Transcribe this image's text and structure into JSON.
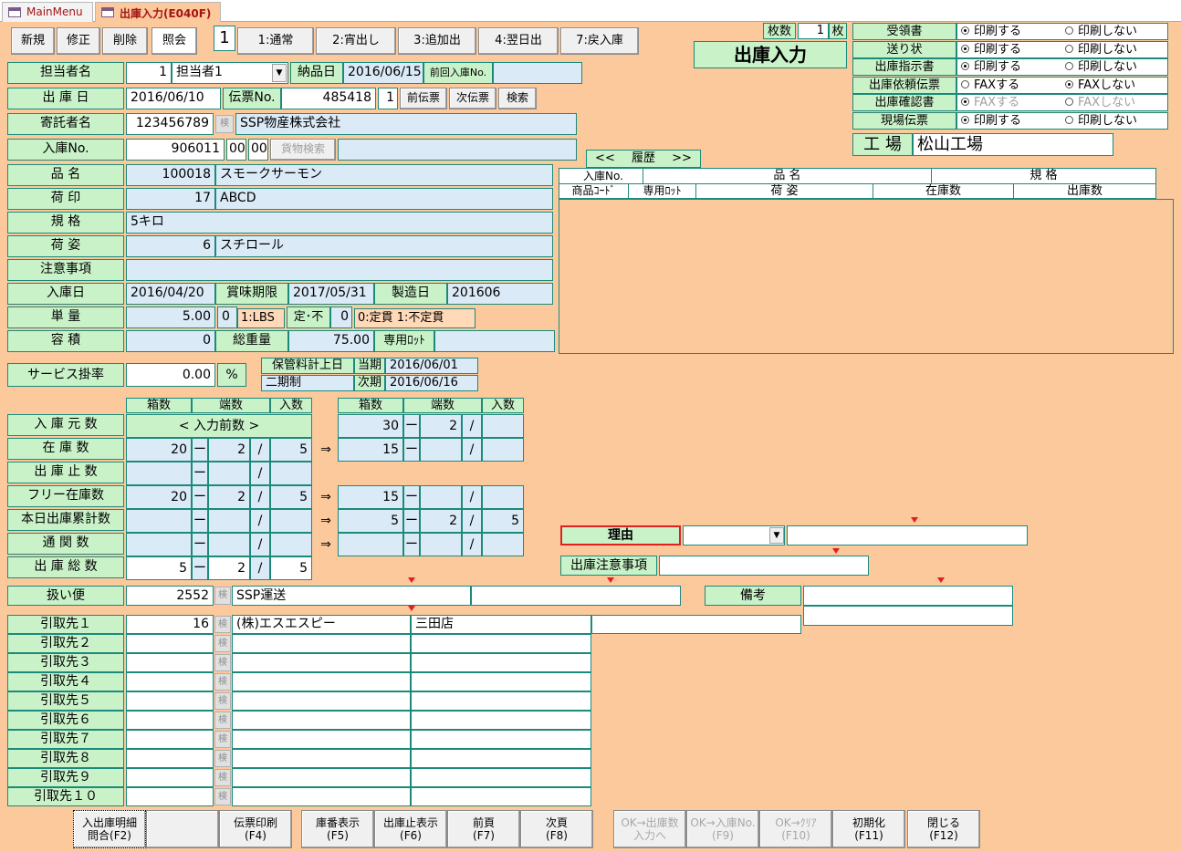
{
  "tabs": {
    "main": "MainMenu",
    "active": "出庫入力(E040F)"
  },
  "modes": {
    "new": "新規",
    "edit": "修正",
    "delete": "削除",
    "view": "照会",
    "current": "1"
  },
  "types": {
    "t1": "1:通常",
    "t2": "2:宵出し",
    "t3": "3:追加出",
    "t4": "4:翌日出",
    "t7": "7:戻入庫"
  },
  "sheets": {
    "label": "枚数",
    "value": "1",
    "unit": "枚"
  },
  "title": "出庫入力",
  "print": {
    "opt_print": "印刷する",
    "opt_noprint": "印刷しない",
    "opt_fax": "FAXする",
    "opt_nofax": "FAXしない",
    "rows": [
      {
        "label": "受領書",
        "sel": "print"
      },
      {
        "label": "送り状",
        "sel": "print"
      },
      {
        "label": "出庫指示書",
        "sel": "print"
      },
      {
        "label": "出庫依頼伝票",
        "sel": "nofax"
      },
      {
        "label": "出庫確認書",
        "sel": "fax"
      },
      {
        "label": "現場伝票",
        "sel": "print"
      }
    ]
  },
  "factory": {
    "label": "工 場",
    "value": "松山工場"
  },
  "form": {
    "staff_label": "担当者名",
    "staff_no": "1",
    "staff_name": "担当者1",
    "delivery_label": "納品日",
    "delivery_date": "2016/06/15",
    "prev_label": "前回入庫No.",
    "ship_label": "出 庫 日",
    "ship_date": "2016/06/10",
    "slip_label": "伝票No.",
    "slip_no": "485418",
    "slip_sub": "1",
    "prev_slip": "前伝票",
    "next_slip": "次伝票",
    "search": "検索",
    "consignor_label": "寄託者名",
    "consignor_code": "123456789",
    "kbtn": "検",
    "consignor_name": "SSP物産株式会社",
    "recv_label": "入庫No.",
    "recv_no": "906011",
    "recv_a": "00",
    "recv_b": "00",
    "cargo_search": "貨物検索",
    "item_label": "品 名",
    "item_code": "100018",
    "item_name": "スモークサーモン",
    "mark_label": "荷 印",
    "mark_code": "17",
    "mark_name": "ABCD",
    "spec_label": "規 格",
    "spec_value": "5キロ",
    "pack_label": "荷 姿",
    "pack_code": "6",
    "pack_name": "スチロール",
    "note_label": "注意事項",
    "indate_label": "入庫日",
    "indate": "2016/04/20",
    "best_label": "賞味期限",
    "best": "2017/05/31",
    "mfg_label": "製造日",
    "mfg": "201606",
    "unit_label": "単 量",
    "unit_value": "5.00",
    "unit_flag": "0",
    "unit_name": "1:LBS",
    "fix_label": "定･不",
    "fix_value": "0",
    "fix_name": "0:定貫 1:不定貫",
    "vol_label": "容 積",
    "vol_value": "0",
    "weight_label": "総重量",
    "weight_value": "75.00",
    "lot_label": "専用ﾛｯﾄ",
    "service_label": "サービス掛率",
    "service_value": "0.00",
    "service_unit": "%",
    "storage_label": "保管料計上日",
    "cur_label": "当期",
    "cur_date": "2016/06/01",
    "period_label": "二期制",
    "next_label": "次期",
    "next_date": "2016/06/16"
  },
  "history": {
    "prev": "<<",
    "label": "履歴",
    "next": ">>",
    "h1": [
      "入庫No.",
      "品 名",
      "規 格"
    ],
    "h2": [
      "商品ｺｰﾄﾞ",
      "専用ﾛｯﾄ",
      "荷 姿",
      "在庫数",
      "出庫数"
    ]
  },
  "qty": {
    "h_box": "箱数",
    "h_frac": "端数",
    "h_in": "入数",
    "arrow": "⇒",
    "dash": "ー",
    "slash": "/",
    "rows": [
      {
        "label": "入 庫 元 数",
        "lbox": "",
        "lfrac": "",
        "lin": "",
        "rbox": "30",
        "rfrac": "2",
        "rin": ""
      },
      {
        "label": "在 庫 数",
        "lbox": "20",
        "lfrac": "2",
        "lin": "5",
        "rbox": "15",
        "rfrac": "",
        "rin": ""
      },
      {
        "label": "出 庫 止 数",
        "lbox": "",
        "lfrac": "",
        "lin": ""
      },
      {
        "label": "フリー在庫数",
        "lbox": "20",
        "lfrac": "2",
        "lin": "5",
        "rbox": "15",
        "rfrac": "",
        "rin": ""
      },
      {
        "label": "本日出庫累計数",
        "lbox": "",
        "lfrac": "",
        "lin": "",
        "rbox": "5",
        "rfrac": "2",
        "rin": "5"
      },
      {
        "label": "通 関 数",
        "lbox": "",
        "lfrac": "",
        "lin": "",
        "rbox": "",
        "rfrac": "",
        "rin": ""
      },
      {
        "label": "出 庫 総 数",
        "lbox": "5",
        "lfrac": "2",
        "lin": "5"
      }
    ],
    "prev_count": "< 入力前数 >"
  },
  "reason": {
    "label": "理由",
    "note_label": "出庫注意事項",
    "remarks_label": "備考"
  },
  "carrier": {
    "label": "扱い便",
    "code": "2552",
    "name": "SSP運送"
  },
  "pickup": {
    "rows": [
      {
        "label": "引取先１",
        "code": "16",
        "name": "(株)エスエスピー",
        "branch": "三田店"
      },
      {
        "label": "引取先２",
        "code": "",
        "name": "",
        "branch": ""
      },
      {
        "label": "引取先３",
        "code": "",
        "name": "",
        "branch": ""
      },
      {
        "label": "引取先４",
        "code": "",
        "name": "",
        "branch": ""
      },
      {
        "label": "引取先５",
        "code": "",
        "name": "",
        "branch": ""
      },
      {
        "label": "引取先６",
        "code": "",
        "name": "",
        "branch": ""
      },
      {
        "label": "引取先７",
        "code": "",
        "name": "",
        "branch": ""
      },
      {
        "label": "引取先８",
        "code": "",
        "name": "",
        "branch": ""
      },
      {
        "label": "引取先９",
        "code": "",
        "name": "",
        "branch": ""
      },
      {
        "label": "引取先１０",
        "code": "",
        "name": "",
        "branch": ""
      }
    ]
  },
  "fkeys": {
    "f2": "入出庫明細\n問合(F2)",
    "f4": "伝票印刷\n(F4)",
    "f5": "庫番表示\n(F5)",
    "f6": "出庫止表示\n(F6)",
    "f7": "前頁\n(F7)",
    "f8": "次頁\n(F8)",
    "f9a": "OK→出庫数\n入力へ",
    "f9": "OK→入庫No.\n(F9)",
    "f10": "OK→ｸﾘｱ\n(F10)",
    "f11": "初期化\n(F11)",
    "f12": "閉じる\n(F12)"
  }
}
